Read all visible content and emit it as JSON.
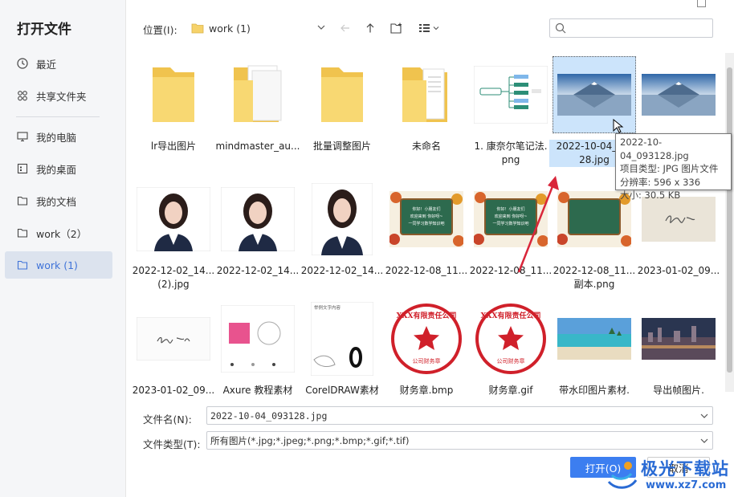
{
  "sidebar": {
    "title": "打开文件",
    "items": [
      {
        "label": "最近",
        "icon": "clock-icon"
      },
      {
        "label": "共享文件夹",
        "icon": "share-icon"
      },
      {
        "label": "我的电脑",
        "icon": "monitor-icon"
      },
      {
        "label": "我的桌面",
        "icon": "desktop-icon"
      },
      {
        "label": "我的文档",
        "icon": "document-folder-icon"
      },
      {
        "label": "work（2）",
        "icon": "folder-icon"
      },
      {
        "label": "work (1)",
        "icon": "folder-icon",
        "active": true
      }
    ]
  },
  "toolbar": {
    "location_label": "位置(I):",
    "location_value": "work (1)",
    "search_placeholder": ""
  },
  "files": [
    {
      "caption": "lr导出图片",
      "type": "folder"
    },
    {
      "caption": "mindmaster_au...",
      "type": "folder-docs"
    },
    {
      "caption": "批量调整图片",
      "type": "folder"
    },
    {
      "caption": "未命名",
      "type": "folder-docs"
    },
    {
      "caption": "1. 康奈尔笔记法.\npng",
      "type": "mindmap"
    },
    {
      "caption": "2022-10-04_0...\n28.jpg",
      "type": "mountain",
      "selected": true
    },
    {
      "caption": "",
      "type": "mountain"
    },
    {
      "caption": "2022-12-02_14...\n(2).jpg",
      "type": "portrait"
    },
    {
      "caption": "2022-12-02_14...",
      "type": "portrait"
    },
    {
      "caption": "2022-12-02_14...",
      "type": "portrait-tall"
    },
    {
      "caption": "2022-12-08_11...",
      "type": "board"
    },
    {
      "caption": "2022-12-08_11...",
      "type": "board"
    },
    {
      "caption": "2022-12-08_11...\n副本.png",
      "type": "board-plain"
    },
    {
      "caption": "2023-01-02_09...",
      "type": "signature"
    },
    {
      "caption": "2023-01-02_09...",
      "type": "signature-white"
    },
    {
      "caption": "Axure 教程素材",
      "type": "axure"
    },
    {
      "caption": "CorelDRAW素材",
      "type": "corel"
    },
    {
      "caption": "财务章.bmp",
      "type": "seal"
    },
    {
      "caption": "财务章.gif",
      "type": "seal"
    },
    {
      "caption": "带水印图片素材.",
      "type": "beach"
    },
    {
      "caption": "导出帧图片.",
      "type": "city"
    }
  ],
  "thumb_text": {
    "board_lines": [
      "你好！小朋友们",
      "欢迎来到 你好呀~",
      "一同学习数学知识吧"
    ],
    "board_plain_lines": [],
    "seal_text": "XXX有限责任公司",
    "seal_sub": "公司财务章",
    "corel_text": "举例文字内容",
    "mindmap_node": "康奈尔笔记法"
  },
  "tooltip": {
    "line1": "2022-10-04_093128.jpg",
    "line2": "项目类型: JPG 图片文件",
    "line3": "分辨率: 596 x 336",
    "line4": "大小: 30.5 KB"
  },
  "bottom": {
    "filename_label": "文件名(N):",
    "filename_value": "2022-10-04_093128.jpg",
    "filetype_label": "文件类型(T):",
    "filetype_value": "所有图片(*.jpg;*.jpeg;*.png;*.bmp;*.gif;*.tif)",
    "open_label": "打开(O)",
    "cancel_label": "取消"
  },
  "watermark": {
    "text": "极光下载站",
    "url": "www.xz7.com"
  },
  "colors": {
    "accent": "#3c7ef0",
    "sidebar_active_bg": "#dce3ee",
    "selection": "#cce4fb",
    "folder": "#f6d26a",
    "arrow": "#d9263a"
  }
}
